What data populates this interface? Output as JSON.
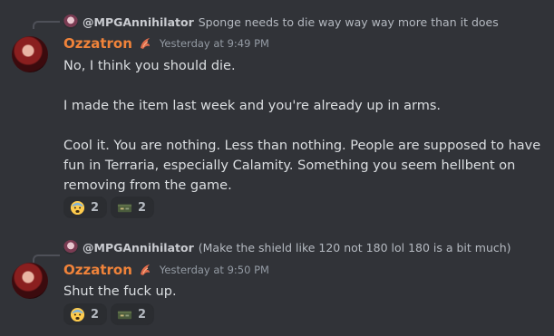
{
  "messages": [
    {
      "reply": {
        "author": "@MPGAnnihilator",
        "text": "Sponge needs to die way way way more than it does"
      },
      "author": "Ozzatron",
      "timestamp": "Yesterday at 9:49 PM",
      "paragraphs": [
        "No, I think you should die.",
        "I made the item last week and you're already up in arms.",
        "Cool it. You are nothing. Less than nothing. People are supposed to have fun in Terraria, especially Calamity. Something you seem hellbent on removing from the game."
      ],
      "reactions": [
        {
          "emoji": "fearful-face",
          "count": "2"
        },
        {
          "emoji": "ammo-crate",
          "count": "2"
        }
      ]
    },
    {
      "reply": {
        "author": "@MPGAnnihilator",
        "text": "(Make the shield like 120 not 180 lol 180 is a bit much)"
      },
      "author": "Ozzatron",
      "timestamp": "Yesterday at 9:50 PM",
      "paragraphs": [
        "Shut the fuck up."
      ],
      "reactions": [
        {
          "emoji": "fearful-face",
          "count": "2"
        },
        {
          "emoji": "ammo-crate",
          "count": "2"
        }
      ]
    }
  ],
  "colors": {
    "background": "#313338",
    "author": "#f0833a",
    "text": "#dbdee1",
    "muted": "#949ba4",
    "reaction_bg": "#2b2d31"
  }
}
